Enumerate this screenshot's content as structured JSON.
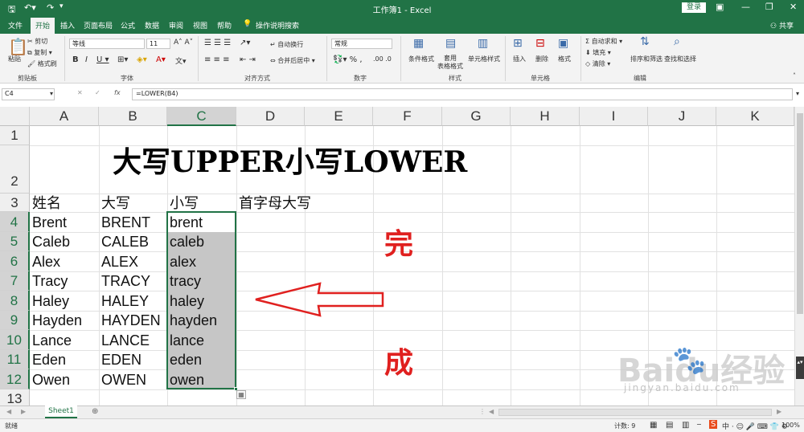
{
  "app": {
    "window_title": "工作簿1 - Excel",
    "login_label": "登录",
    "share_label": "共享",
    "tell_me": "操作说明搜索"
  },
  "tabs": [
    "文件",
    "开始",
    "插入",
    "页面布局",
    "公式",
    "数据",
    "审阅",
    "视图",
    "帮助"
  ],
  "active_tab": "开始",
  "ribbon": {
    "clipboard": {
      "paste": "粘贴",
      "cut": "剪切",
      "copy": "复制",
      "format_painter": "格式刷",
      "group": "剪贴板"
    },
    "font": {
      "name": "等线",
      "size": "11",
      "group": "字体"
    },
    "alignment": {
      "wrap": "自动换行",
      "merge": "合并后居中",
      "group": "对齐方式"
    },
    "number": {
      "format": "常规",
      "group": "数字"
    },
    "styles": {
      "conditional": "条件格式",
      "table": "套用\n表格格式",
      "cell_styles": "单元格样式",
      "group": "样式"
    },
    "cells": {
      "insert": "插入",
      "delete": "删除",
      "format": "格式",
      "group": "单元格"
    },
    "editing": {
      "autosum": "自动求和",
      "fill": "填充",
      "clear": "清除",
      "sort": "排序和筛选",
      "find": "查找和选择",
      "group": "编辑"
    }
  },
  "formula_bar": {
    "name_box": "C4",
    "formula": "=LOWER(B4)"
  },
  "columns": [
    "A",
    "B",
    "C",
    "D",
    "E",
    "F",
    "G",
    "H",
    "I",
    "J",
    "K"
  ],
  "selected_column": "C",
  "rows": [
    "1",
    "2",
    "3",
    "4",
    "5",
    "6",
    "7",
    "8",
    "9",
    "10",
    "11",
    "12",
    "13"
  ],
  "selected_rows": [
    "4",
    "5",
    "6",
    "7",
    "8",
    "9",
    "10",
    "11",
    "12"
  ],
  "sheet": {
    "heading": "大写UPPER小写LOWER",
    "header_row": [
      "姓名",
      "大写",
      "小写",
      "首字母大写"
    ],
    "data": [
      [
        "Brent",
        "BRENT",
        "brent"
      ],
      [
        "Caleb",
        "CALEB",
        "caleb"
      ],
      [
        "Alex",
        "ALEX",
        "alex"
      ],
      [
        "Tracy",
        "TRACY",
        "tracy"
      ],
      [
        "Haley",
        "HALEY",
        "haley"
      ],
      [
        "Hayden",
        "HAYDEN",
        "hayden"
      ],
      [
        "Lance",
        "LANCE",
        "lance"
      ],
      [
        "Eden",
        "EDEN",
        "eden"
      ],
      [
        "Owen",
        "OWEN",
        "owen"
      ]
    ],
    "annotation_top": "完",
    "annotation_bottom": "成",
    "arrow_color": "#e0201f"
  },
  "sheet_tabs": [
    "Sheet1"
  ],
  "status": {
    "ready": "就绪",
    "count": "计数: 9",
    "zoom": "100%"
  },
  "watermark": {
    "brand": "Baidu经验",
    "url": "jingyan.baidu.com"
  },
  "colors": {
    "excel_green": "#217346",
    "selection_fill": "#c6c6c6"
  }
}
